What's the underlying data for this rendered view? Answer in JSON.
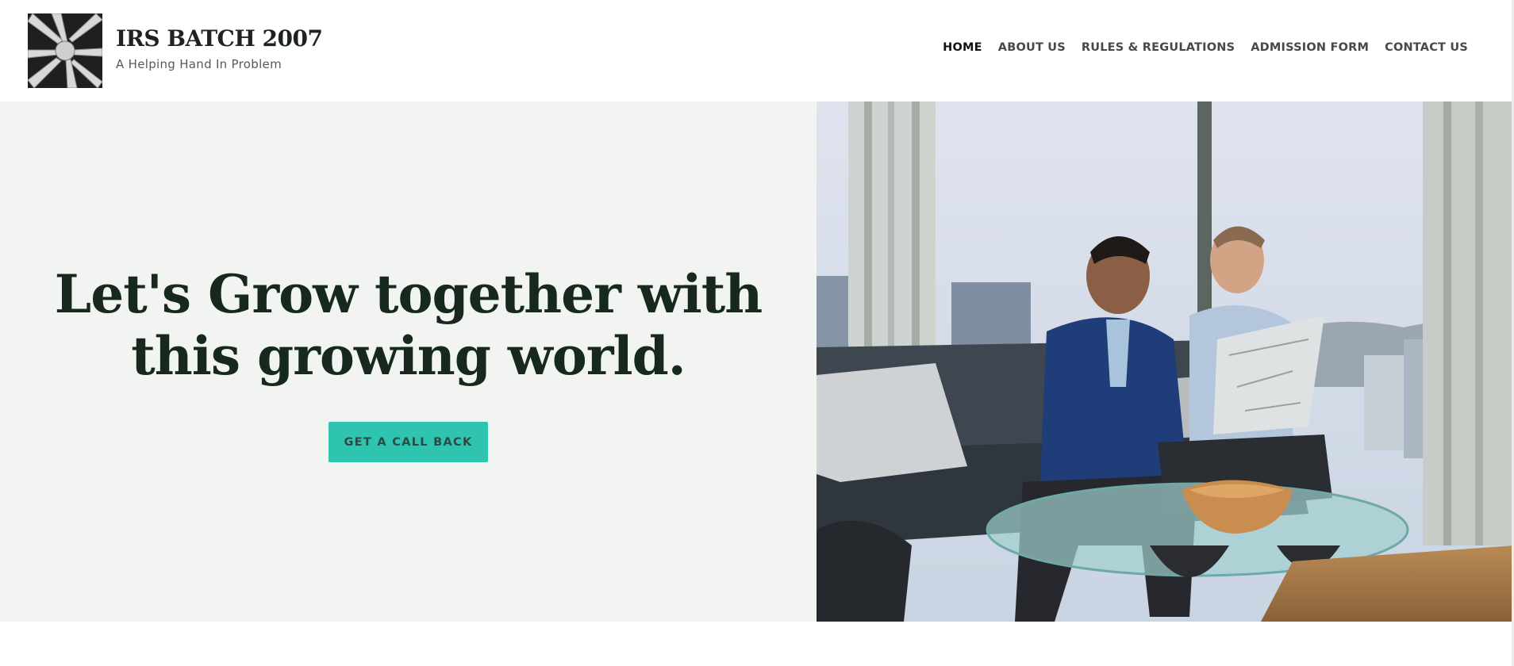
{
  "site": {
    "title": "IRS BATCH 2007",
    "tagline": "A Helping Hand In Problem"
  },
  "nav": {
    "items": [
      {
        "label": "HOME",
        "active": true
      },
      {
        "label": "ABOUT US",
        "active": false
      },
      {
        "label": "RULES & REGULATIONS",
        "active": false
      },
      {
        "label": "ADMISSION FORM",
        "active": false
      },
      {
        "label": "CONTACT US",
        "active": false
      }
    ]
  },
  "hero": {
    "heading_line1": "Let's Grow together with",
    "heading_line2": "this growing world.",
    "cta_label": "GET A CALL BACK",
    "image_icon": "business-meeting-photo"
  },
  "colors": {
    "accent": "#2ec4b0",
    "heading": "#17291f",
    "hero_bg": "#f2f4f2"
  }
}
